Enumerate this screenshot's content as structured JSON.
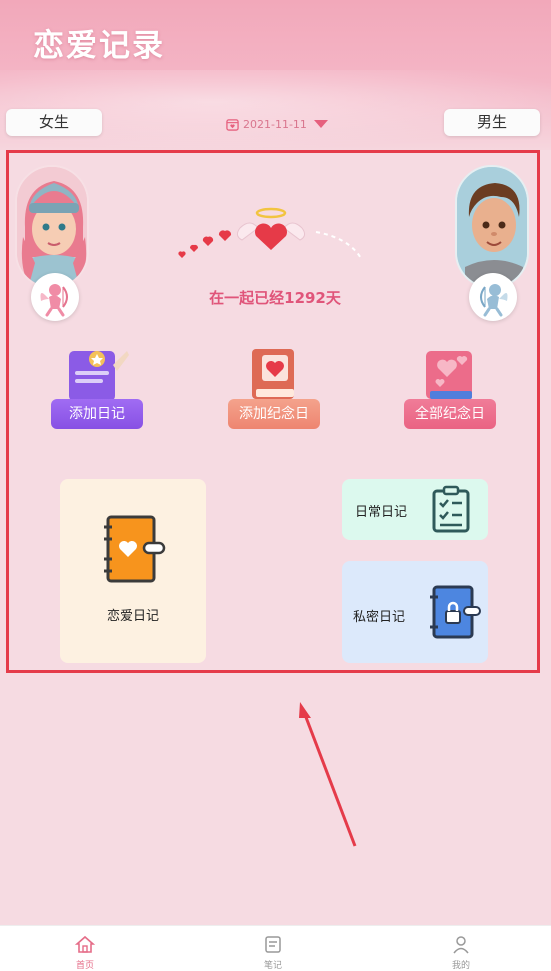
{
  "app": {
    "title": "恋爱记录"
  },
  "header": {
    "female_label": "女生",
    "male_label": "男生",
    "date": "2021-11-11"
  },
  "couple": {
    "days_text": "在一起已经1292天"
  },
  "actions": [
    {
      "label": "添加日记",
      "color": "#9a5cf0"
    },
    {
      "label": "添加纪念日",
      "color": "#f19078"
    },
    {
      "label": "全部纪念日",
      "color": "#ec6f8f"
    }
  ],
  "diaries": {
    "love": {
      "label": "恋爱日记",
      "bg": "#fdf1e1"
    },
    "daily": {
      "label": "日常日记",
      "bg": "#dcf9ee"
    },
    "secret": {
      "label": "私密日记",
      "bg": "#dce9fb"
    }
  },
  "nav": [
    {
      "label": "首页",
      "icon": "home-icon",
      "active": true
    },
    {
      "label": "笔记",
      "icon": "notes-icon",
      "active": false
    },
    {
      "label": "我的",
      "icon": "profile-icon",
      "active": false
    }
  ],
  "colors": {
    "accent": "#e0557a",
    "annotation": "#e53b4a"
  }
}
